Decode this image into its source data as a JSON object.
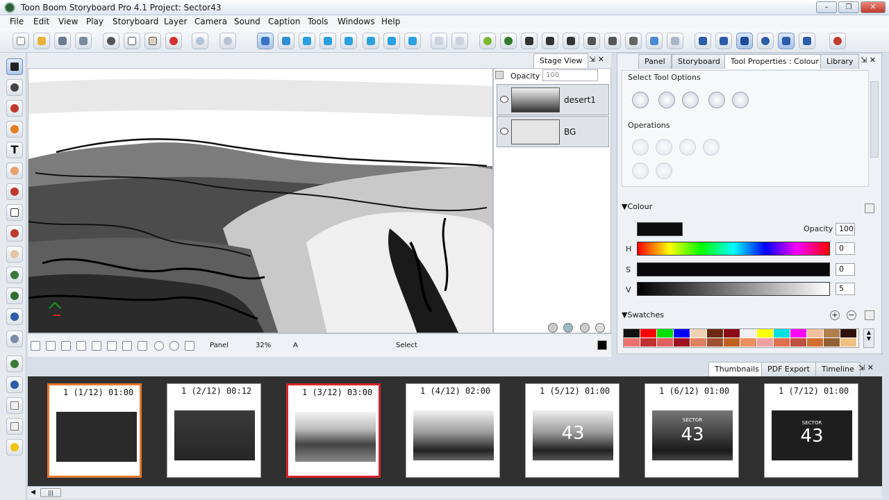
{
  "window": {
    "title": "Toon Boom Storyboard Pro 4.1 Project: Sector43",
    "minimize": "–",
    "maximize": "❐",
    "close": "✕"
  },
  "menu": [
    "File",
    "Edit",
    "View",
    "Play",
    "Storyboard",
    "Layer",
    "Camera",
    "Sound",
    "Caption",
    "Tools",
    "Windows",
    "Help"
  ],
  "stage": {
    "tab_label": "Stage View",
    "opacity_label": "Opacity",
    "opacity_value": "100"
  },
  "layers": [
    {
      "name": "desert1"
    },
    {
      "name": "BG"
    }
  ],
  "status": {
    "mode": "Panel",
    "zoom": "32%",
    "a_label": "A",
    "tool": "Select"
  },
  "right_tabs": [
    "Panel",
    "Storyboard",
    "Tool Properties : Colour",
    "Library"
  ],
  "tool_props": {
    "select_options_label": "Select Tool Options",
    "operations_label": "Operations"
  },
  "colour": {
    "section_label": "Colour",
    "opacity_label": "Opacity",
    "opacity_value": "100",
    "h_label": "H",
    "h_value": "0",
    "s_label": "S",
    "s_value": "0",
    "v_label": "V",
    "v_value": "5",
    "current_color": "#0d0d0d"
  },
  "swatches": {
    "section_label": "Swatches",
    "row1": [
      "#111111",
      "#ff0000",
      "#00e000",
      "#0000ff",
      "#f2d2b4",
      "#6a2a14",
      "#8a0a18",
      "#f0f0f0",
      "#ffff00",
      "#00e0e0",
      "#ff00ff",
      "#f0c0a0",
      "#b08050",
      "#301008"
    ],
    "row2": [
      "#f07070",
      "#c03030",
      "#e06060",
      "#a01020",
      "#e08060",
      "#a05030",
      "#c06020",
      "#f09060",
      "#f0a0a0",
      "#e07050",
      "#c05040",
      "#d07030",
      "#906030",
      "#f0c080"
    ]
  },
  "bottom_tabs": [
    "Thumbnails",
    "PDF Export",
    "Timeline"
  ],
  "thumbnails": [
    {
      "label": "1 (1/12) 01:00",
      "text": ""
    },
    {
      "label": "1 (2/12) 00:12",
      "text": ""
    },
    {
      "label": "1 (3/12) 03:00",
      "text": ""
    },
    {
      "label": "1 (4/12) 02:00",
      "text": ""
    },
    {
      "label": "1 (5/12) 01:00",
      "text": "43"
    },
    {
      "label": "1 (6/12) 01:00",
      "small": "SECTOR",
      "text": "43"
    },
    {
      "label": "1 (7/12) 01:00",
      "small": "SECTOR",
      "text": "43"
    }
  ],
  "scrollbar_grip": "|||"
}
